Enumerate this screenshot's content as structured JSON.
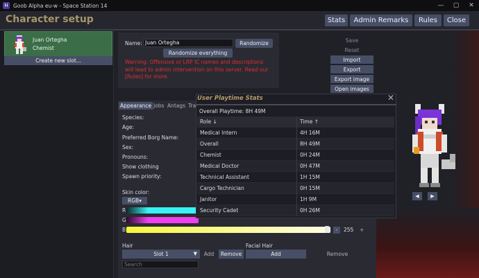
{
  "window": {
    "title": "Goob Alpha eu-w - Space Station 14",
    "icon_glyph": "H"
  },
  "header": {
    "title": "Character setup",
    "buttons": {
      "stats": "Stats",
      "admin_remarks": "Admin Remarks",
      "rules": "Rules",
      "close": "Close"
    }
  },
  "character_list": {
    "selected": {
      "name": "Juan Ortegha",
      "job": "Chemist"
    },
    "create_new": "Create new slot..."
  },
  "profile": {
    "name_label": "Name:",
    "name_value": "Juan Ortegha",
    "randomize": "Randomize",
    "randomize_everything": "Randomize everything",
    "warning": "Warning: Offensive or LRP IC names and descriptions will lead to admin intervention on this server. Read our [Rules] for more."
  },
  "side_buttons": {
    "save": "Save",
    "reset": "Reset",
    "import": "Import",
    "export": "Export",
    "export_image": "Export image",
    "open_images": "Open images"
  },
  "tabs": {
    "appearance": "Appearance",
    "jobs": "Jobs",
    "antags": "Antags",
    "traits": "Tra"
  },
  "appearance_fields": {
    "species": "Species:",
    "age": "Age:",
    "borg_name": "Preferred Borg Name:",
    "sex": "Sex:",
    "pronouns": "Pronouns:",
    "show_clothing": "Show clothing",
    "spawn_priority": "Spawn priority:",
    "skin_color": "Skin color:",
    "color_mode": "RGB▾"
  },
  "sliders": {
    "r_label": "R",
    "g_label": "G",
    "b_label": "B",
    "b_minus": "-",
    "b_value": "255",
    "b_plus": "+",
    "r_color": "#37f3f3",
    "g_color": "#f03ef0",
    "b_color": "#f6f63c"
  },
  "hair": {
    "hair_label": "Hair",
    "facial_label": "Facial Hair",
    "slot": "Slot 1",
    "add": "Add",
    "remove": "Remove",
    "facial_add": "Add",
    "facial_remove": "Remove",
    "search_placeholder": "Search"
  },
  "playtime": {
    "title": "User Playtime Stats",
    "close": "✕",
    "overall": "Overall Playtime: 8H 49M",
    "col_role": "Role ↓",
    "col_time": "Time ↑",
    "rows": [
      {
        "role": "Medical Intern",
        "time": "4H 16M"
      },
      {
        "role": "Overall",
        "time": "8H 49M"
      },
      {
        "role": "Chemist",
        "time": "0H 24M"
      },
      {
        "role": "Medical Doctor",
        "time": "0H 47M"
      },
      {
        "role": "Technical Assistant",
        "time": "1H 15M"
      },
      {
        "role": "Cargo Technician",
        "time": "0H 15M"
      },
      {
        "role": "Janitor",
        "time": "1H 9M"
      },
      {
        "role": "Security Cadet",
        "time": "0H 26M"
      }
    ]
  },
  "preview": {
    "rotate_left": "◀",
    "rotate_right": "▶"
  }
}
